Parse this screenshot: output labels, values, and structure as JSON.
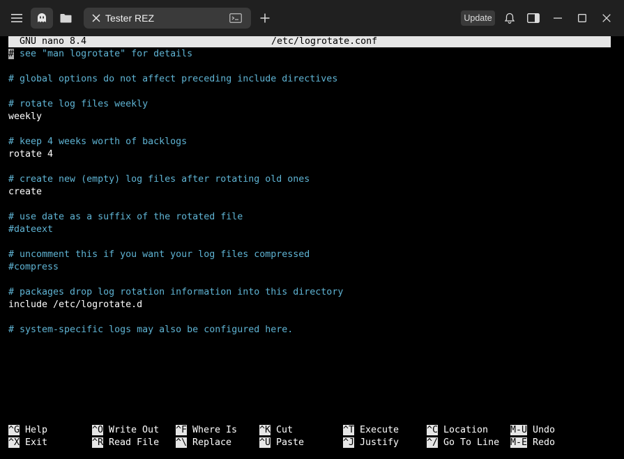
{
  "titlebar": {
    "tab_title": "Tester REZ",
    "update_label": "Update",
    "icons": {
      "menu": "hamburger-menu-icon",
      "ghost": "ghost-icon",
      "folder": "folder-icon",
      "tab_close": "close-icon",
      "tab_terminal": "terminal-icon",
      "new_tab": "plus-icon",
      "bell": "bell-icon",
      "sidebar": "sidebar-toggle-icon",
      "minimize": "minimize-icon",
      "maximize": "maximize-icon",
      "close": "close-icon"
    }
  },
  "nano": {
    "version": "GNU nano 8.4",
    "filename": "/etc/logrotate.conf",
    "lines": [
      {
        "text": "# see \"man logrotate\" for details",
        "type": "comment"
      },
      {
        "text": "",
        "type": "plain"
      },
      {
        "text": "# global options do not affect preceding include directives",
        "type": "comment"
      },
      {
        "text": "",
        "type": "plain"
      },
      {
        "text": "# rotate log files weekly",
        "type": "comment"
      },
      {
        "text": "weekly",
        "type": "plain"
      },
      {
        "text": "",
        "type": "plain"
      },
      {
        "text": "# keep 4 weeks worth of backlogs",
        "type": "comment"
      },
      {
        "text": "rotate 4",
        "type": "plain"
      },
      {
        "text": "",
        "type": "plain"
      },
      {
        "text": "# create new (empty) log files after rotating old ones",
        "type": "comment"
      },
      {
        "text": "create",
        "type": "plain"
      },
      {
        "text": "",
        "type": "plain"
      },
      {
        "text": "# use date as a suffix of the rotated file",
        "type": "comment"
      },
      {
        "text": "#dateext",
        "type": "comment"
      },
      {
        "text": "",
        "type": "plain"
      },
      {
        "text": "# uncomment this if you want your log files compressed",
        "type": "comment"
      },
      {
        "text": "#compress",
        "type": "comment"
      },
      {
        "text": "",
        "type": "plain"
      },
      {
        "text": "# packages drop log rotation information into this directory",
        "type": "comment"
      },
      {
        "text": "include /etc/logrotate.d",
        "type": "plain"
      },
      {
        "text": "",
        "type": "plain"
      },
      {
        "text": "# system-specific logs may also be configured here.",
        "type": "comment"
      }
    ],
    "shortcuts_row1": [
      {
        "key": "^G",
        "label": "Help"
      },
      {
        "key": "^O",
        "label": "Write Out"
      },
      {
        "key": "^F",
        "label": "Where Is"
      },
      {
        "key": "^K",
        "label": "Cut"
      },
      {
        "key": "^T",
        "label": "Execute"
      },
      {
        "key": "^C",
        "label": "Location"
      },
      {
        "key": "M-U",
        "label": "Undo"
      }
    ],
    "shortcuts_row2": [
      {
        "key": "^X",
        "label": "Exit"
      },
      {
        "key": "^R",
        "label": "Read File"
      },
      {
        "key": "^\\",
        "label": "Replace"
      },
      {
        "key": "^U",
        "label": "Paste"
      },
      {
        "key": "^J",
        "label": "Justify"
      },
      {
        "key": "^/",
        "label": "Go To Line"
      },
      {
        "key": "M-E",
        "label": "Redo"
      }
    ]
  },
  "colors": {
    "background": "#000000",
    "titlebar": "#202020",
    "tab": "#3a3a3a",
    "comment": "#5fb4d4",
    "header_bar": "#e6e6e6"
  }
}
